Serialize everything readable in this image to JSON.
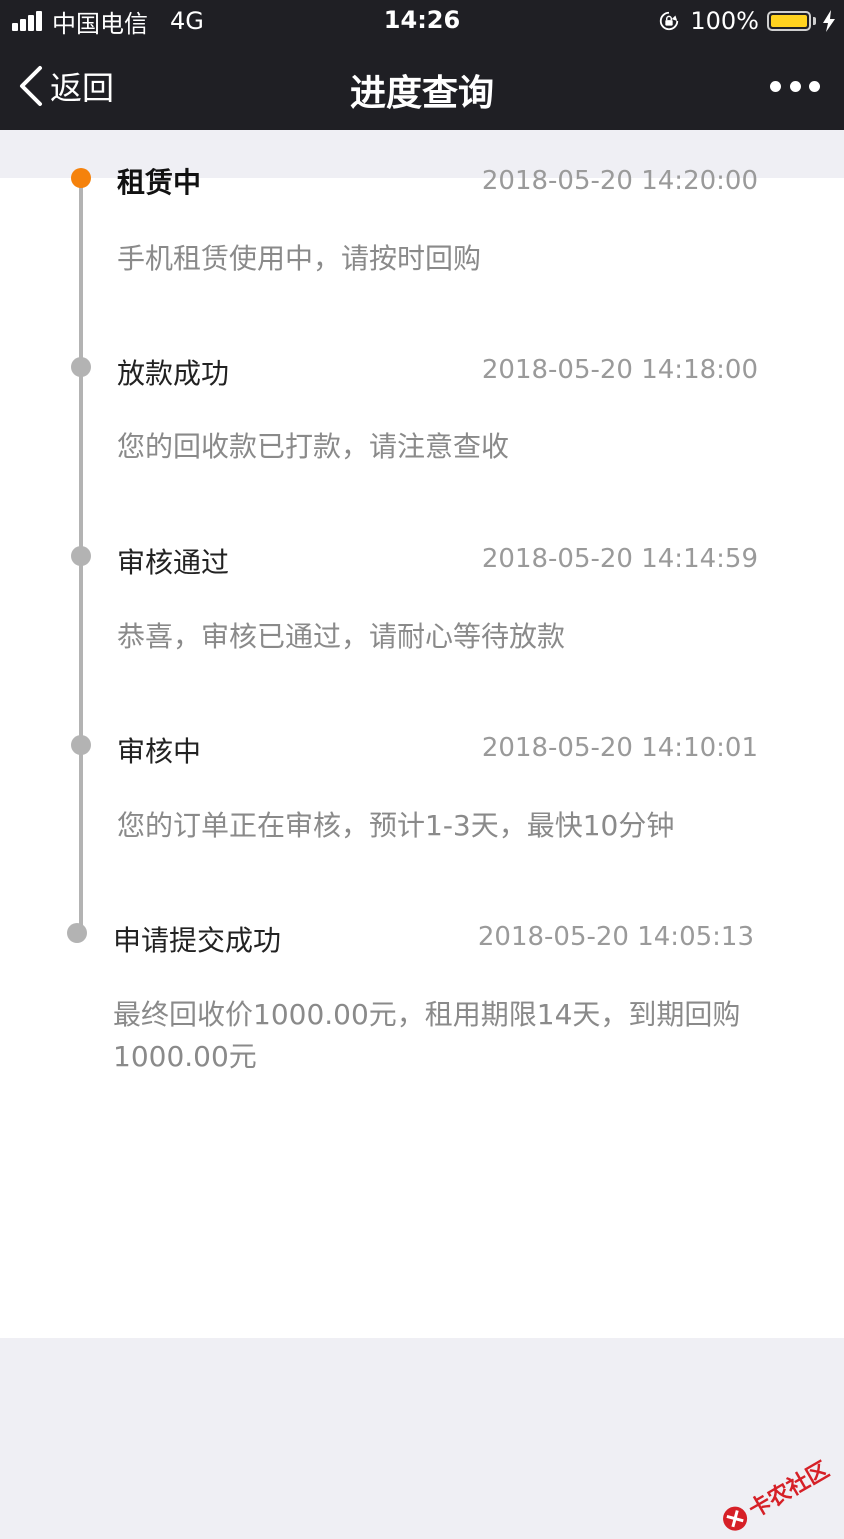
{
  "status_bar": {
    "carrier": "中国电信",
    "network": "4G",
    "time": "14:26",
    "battery": "100%",
    "battery_level": 1.0,
    "battery_color": "#ffd21f"
  },
  "nav": {
    "back_label": "返回",
    "title": "进度查询"
  },
  "colors": {
    "accent": "#f5820c",
    "inactive_dot": "#b3b3b3",
    "header_bg": "#1f1f24"
  },
  "timeline": [
    {
      "title": "租赁中",
      "time": "2018-05-20 14:20:00",
      "desc": "手机租赁使用中，请按时回购",
      "active": true
    },
    {
      "title": "放款成功",
      "time": "2018-05-20 14:18:00",
      "desc": "您的回收款已打款，请注意查收",
      "active": false
    },
    {
      "title": "审核通过",
      "time": "2018-05-20 14:14:59",
      "desc": "恭喜，审核已通过，请耐心等待放款",
      "active": false
    },
    {
      "title": "审核中",
      "time": "2018-05-20 14:10:01",
      "desc": "您的订单正在审核，预计1-3天，最快10分钟",
      "active": false
    },
    {
      "title": "申请提交成功",
      "time": "2018-05-20 14:05:13",
      "desc": "最终回收价1000.00元，租用期限14天，到期回购1000.00元",
      "active": false
    }
  ],
  "watermark": {
    "text": "卡农社区"
  }
}
